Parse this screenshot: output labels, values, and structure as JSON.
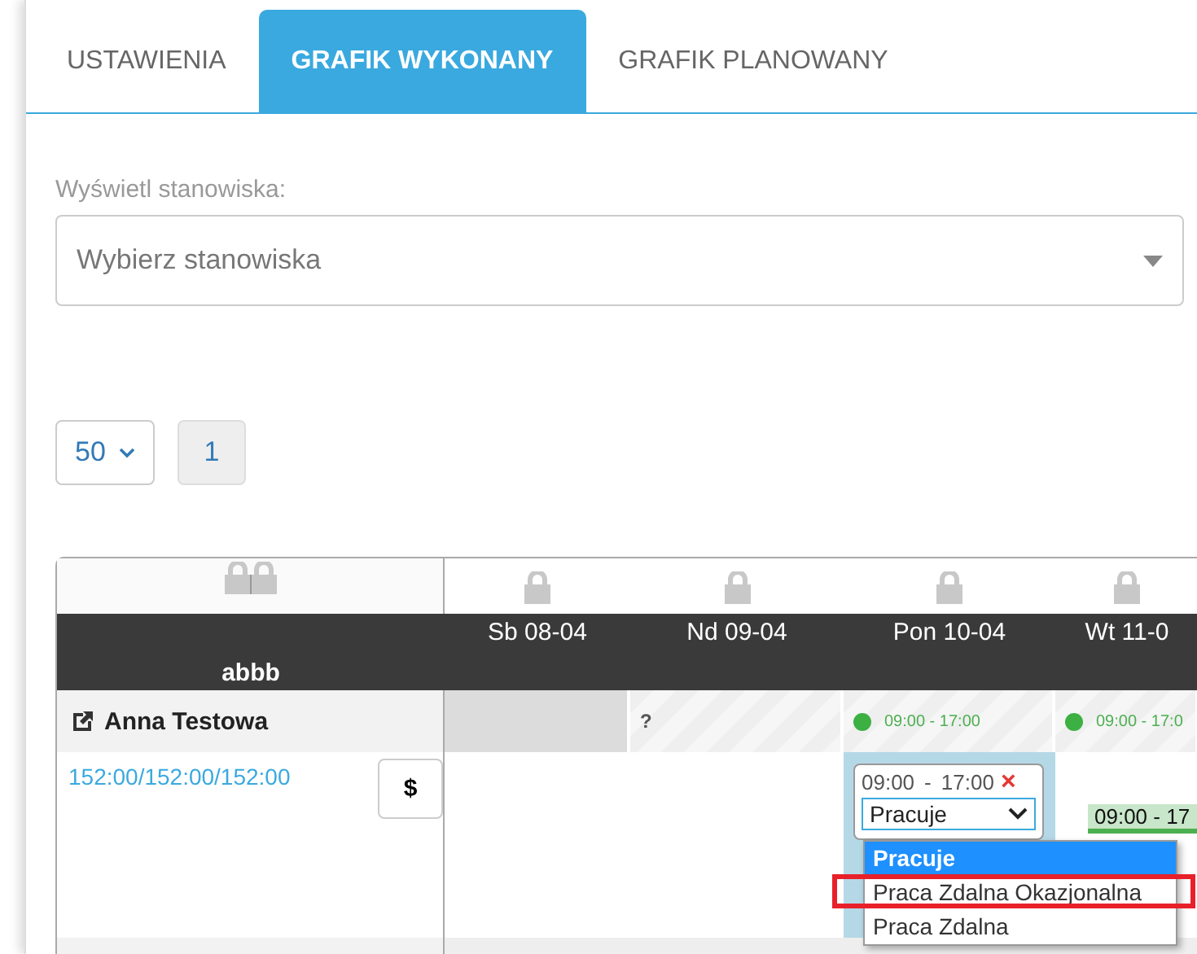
{
  "tabs": [
    {
      "label": "USTAWIENIA",
      "selected": false
    },
    {
      "label": "GRAFIK WYKONANY",
      "selected": true
    },
    {
      "label": "GRAFIK PLANOWANY",
      "selected": false
    }
  ],
  "positions_filter": {
    "label": "Wyświetl stanowiska:",
    "placeholder": "Wybierz stanowiska"
  },
  "pagination": {
    "page_size": "50",
    "pages": [
      "1"
    ]
  },
  "table": {
    "group": "abbb",
    "days": [
      {
        "label": "Sb 08-04",
        "kind": "off"
      },
      {
        "label": "Nd 09-04",
        "kind": "unknown",
        "mark": "?"
      },
      {
        "label": "Pon 10-04",
        "kind": "shift",
        "time": "09:00 - 17:00",
        "editing": true
      },
      {
        "label": "Wt 11-0",
        "kind": "shift",
        "time": "09:00 - 17:0",
        "chip": "09:00 - 17"
      }
    ],
    "employee": {
      "name": "Anna Testowa",
      "hours": "152:00/152:00/152:00",
      "pay_button": "$"
    },
    "editor": {
      "start": "09:00",
      "separator": "-",
      "end": "17:00",
      "close": "×",
      "status": "Pracuje",
      "options": [
        {
          "label": "Pracuje",
          "selected": true,
          "marked": false
        },
        {
          "label": "Praca Zdalna Okazjonalna",
          "selected": false,
          "marked": true
        },
        {
          "label": "Praca Zdalna",
          "selected": false,
          "marked": false
        }
      ]
    }
  }
}
